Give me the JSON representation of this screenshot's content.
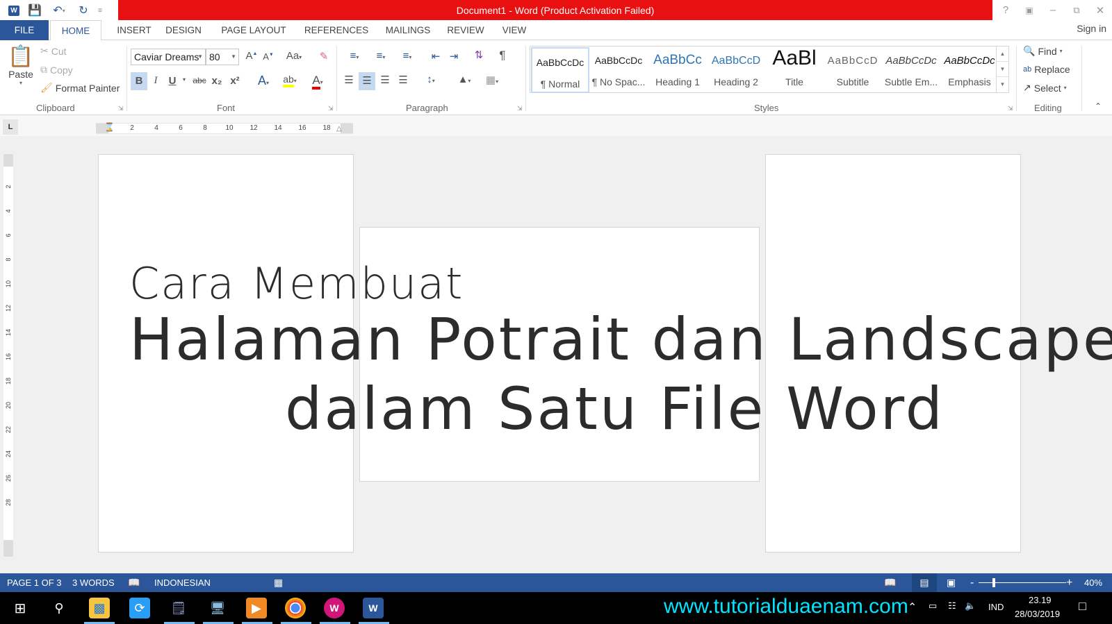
{
  "window": {
    "title": "Document1 -  Word (Product Activation Failed)",
    "controls": [
      "help-icon",
      "ribbon-display-icon",
      "minimize-icon",
      "restore-icon",
      "close-icon"
    ],
    "sign_in": "Sign in",
    "accent": "#2b579a",
    "title_bar_color": "#e81010"
  },
  "quick_access": [
    "word-logo-icon",
    "save-icon",
    "undo-icon",
    "redo-icon",
    "customize-icon"
  ],
  "tabs": [
    {
      "label": "FILE",
      "active": false
    },
    {
      "label": "HOME",
      "active": true
    },
    {
      "label": "INSERT",
      "active": false
    },
    {
      "label": "DESIGN",
      "active": false
    },
    {
      "label": "PAGE LAYOUT",
      "active": false
    },
    {
      "label": "REFERENCES",
      "active": false
    },
    {
      "label": "MAILINGS",
      "active": false
    },
    {
      "label": "REVIEW",
      "active": false
    },
    {
      "label": "VIEW",
      "active": false
    }
  ],
  "ribbon": {
    "clipboard": {
      "label": "Clipboard",
      "paste": "Paste",
      "cut": "Cut",
      "copy": "Copy",
      "format_painter": "Format Painter"
    },
    "font": {
      "label": "Font",
      "font_name": "Caviar Dreams",
      "font_size": "80",
      "change_case": "Aa",
      "bold_active": true,
      "buttons": [
        "B",
        "I",
        "U",
        "abc",
        "x₂",
        "x²"
      ]
    },
    "paragraph": {
      "label": "Paragraph",
      "alignment": "center"
    },
    "styles": {
      "label": "Styles",
      "items": [
        {
          "preview": "AaBbCcDc",
          "label": "¶ Normal",
          "active": true
        },
        {
          "preview": "AaBbCcDc",
          "label": "¶ No Spac...",
          "active": false
        },
        {
          "preview": "AaBbCc",
          "label": "Heading 1",
          "active": false
        },
        {
          "preview": "AaBbCcD",
          "label": "Heading 2",
          "active": false
        },
        {
          "preview": "AaBl",
          "label": "Title",
          "active": false
        },
        {
          "preview": "AaBbCcD",
          "label": "Subtitle",
          "active": false
        },
        {
          "preview": "AaBbCcDc",
          "label": "Subtle Em...",
          "active": false
        },
        {
          "preview": "AaBbCcDc",
          "label": "Emphasis",
          "active": false
        }
      ]
    },
    "editing": {
      "label": "Editing",
      "find": "Find",
      "replace": "Replace",
      "select": "Select"
    }
  },
  "ruler": {
    "horizontal_ticks": [
      "2",
      "4",
      "6",
      "8",
      "10",
      "12",
      "14",
      "16",
      "18"
    ],
    "vertical_ticks": [
      "2",
      "4",
      "6",
      "8",
      "10",
      "12",
      "14",
      "16",
      "18",
      "20",
      "22",
      "24",
      "26",
      "28"
    ],
    "tab_selector": "L"
  },
  "document": {
    "line1": "Cara Membuat",
    "line2": "Halaman Potrait dan Landscape",
    "line3": "dalam Satu File Word",
    "pages": [
      "portrait",
      "landscape",
      "portrait"
    ]
  },
  "status": {
    "page": "PAGE 1 OF 3",
    "words": "3 WORDS",
    "language": "INDONESIAN",
    "zoom": "40%",
    "zoom_fraction": 0.4
  },
  "taskbar": {
    "apps": [
      "windows-start-icon",
      "search-icon",
      "file-explorer-icon",
      "shareit-icon",
      "notepad-icon",
      "remote-desktop-icon",
      "media-player-icon",
      "chrome-icon",
      "wps-beta-icon",
      "word-icon"
    ],
    "watermark": "www.tutorialduaenam.com",
    "language": "IND",
    "time": "23.19",
    "date": "28/03/2019"
  }
}
